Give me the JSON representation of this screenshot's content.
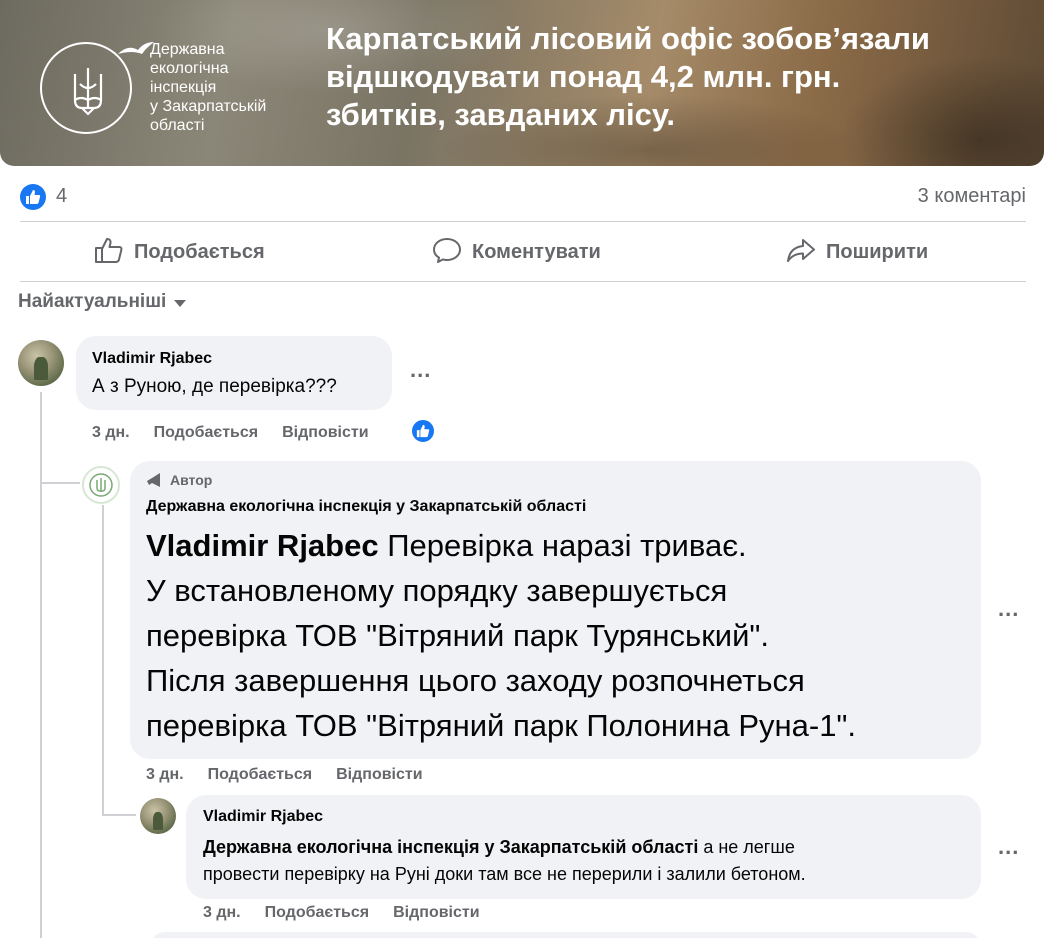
{
  "banner": {
    "org_lines": [
      "Державна",
      "екологічна",
      "інспекція",
      "у Закарпатській",
      "області"
    ],
    "headline_lines": [
      "Карпатський лісовий офіс зобов’язали",
      "відшкодувати понад 4,2 млн. грн.",
      "збитків, завданих лісу."
    ],
    "emblem_icon": "trident-icon"
  },
  "reactions": {
    "count": "4",
    "comments": "3 коментарі",
    "icon": "like-icon"
  },
  "actions": {
    "like": "Подобається",
    "comment": "Коментувати",
    "share": "Поширити"
  },
  "sort": {
    "label": "Найактуальніші"
  },
  "comments": [
    {
      "author": "Vladimir Rjabec",
      "text": "А з Руною, де перевірка???",
      "time": "3 дн.",
      "like": "Подобається",
      "reply": "Відповісти"
    },
    {
      "badge": "Автор",
      "author": "Державна екологічна інспекція у Закарпатській області",
      "mention": "Vladimir Rjabec",
      "text_first": " Перевірка наразі триває.",
      "text_lines": [
        "У встановленому порядку завершується",
        "перевірка ТОВ \"Вітряний парк Турянський\".",
        "Після завершення цього заходу розпочнеться",
        "перевірка ТОВ \"Вітряний парк Полонина Руна-1\"."
      ],
      "time": "3 дн.",
      "like": "Подобається",
      "reply": "Відповісти"
    },
    {
      "author": "Vladimir Rjabec",
      "mention": "Державна екологічна інспекція у Закарпатській області",
      "text_first": " а не легше",
      "text_second": "провести перевірку на Руні доки там все не перерили і залили бетоном.",
      "time": "3 дн.",
      "like": "Подобається",
      "reply": "Відповісти"
    }
  ],
  "more_label": "...",
  "colors": {
    "facebook_blue": "#1877f2",
    "bubble_bg": "#f0f2f5",
    "muted_text": "#65676b"
  }
}
